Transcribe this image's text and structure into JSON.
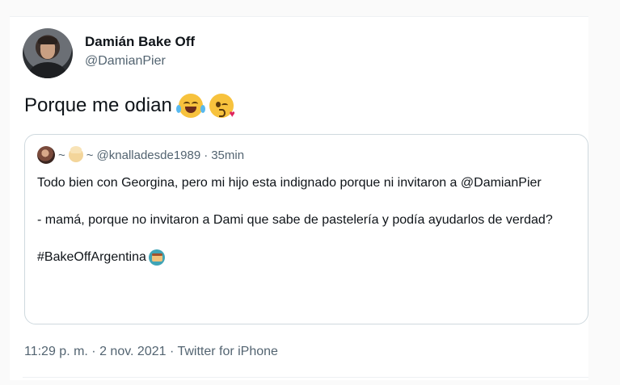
{
  "author": {
    "display_name": "Damián Bake Off",
    "handle": "@DamianPier"
  },
  "tweet": {
    "text": "Porque me odian",
    "emojis": [
      "tears-of-joy-icon",
      "face-blowing-kiss-icon"
    ]
  },
  "quoted_tweet": {
    "name_separator_1": "~",
    "name_separator_2": "~",
    "handle": "@knalladesde1989",
    "time_separator": "·",
    "relative_time": "35min",
    "line1": "Todo bien con Georgina, pero mi hijo esta indignado porque ni invitaron a @DamianPier",
    "line2": "- mamá, porque no invitaron a Dami que sabe de pastelería y podía ayudarlos de verdad?",
    "hashtag": "#BakeOffArgentina"
  },
  "meta": {
    "timestamp": "11:29 p. m. · 2 nov. 2021 · Twitter for iPhone"
  },
  "colors": {
    "text_primary": "#0f1419",
    "text_secondary": "#536471",
    "border": "#cfd9de"
  }
}
